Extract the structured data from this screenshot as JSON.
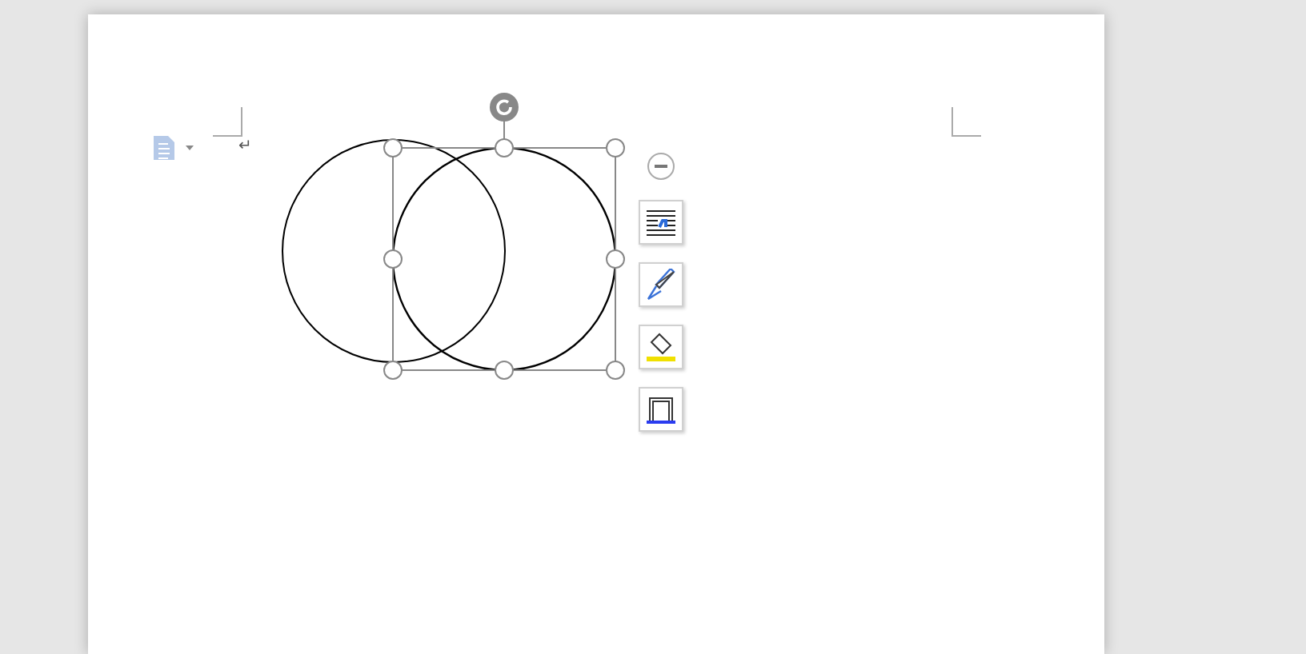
{
  "paragraph_mark": "↵",
  "shapes": [
    {
      "kind": "circle",
      "selected": false
    },
    {
      "kind": "circle",
      "selected": true
    }
  ]
}
